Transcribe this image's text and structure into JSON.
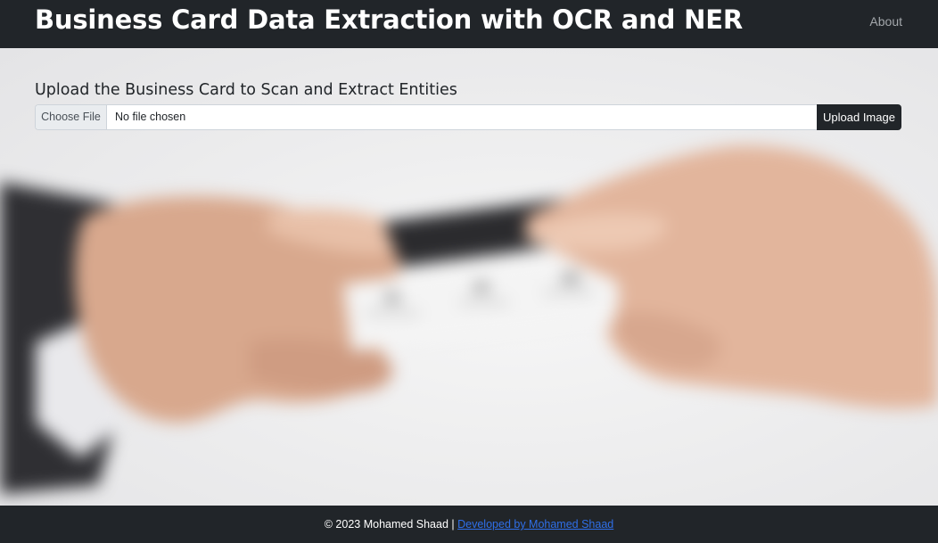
{
  "navbar": {
    "title": "Business Card Data Extraction with OCR and NER",
    "about_label": "About"
  },
  "upload": {
    "heading": "Upload the Business Card to Scan and Extract Entities",
    "choose_file_label": "Choose File",
    "file_status": "No file chosen",
    "submit_label": "Upload Image"
  },
  "hero_image": {
    "description": "hands exchanging business card"
  },
  "footer": {
    "copyright": "© 2023 Mohamed Shaad",
    "separator": " | ",
    "link_label": "Developed by Mohamed Shaad"
  },
  "colors": {
    "navbar_bg": "#212529",
    "link": "#2f6fe8",
    "button_bg": "#212529"
  }
}
